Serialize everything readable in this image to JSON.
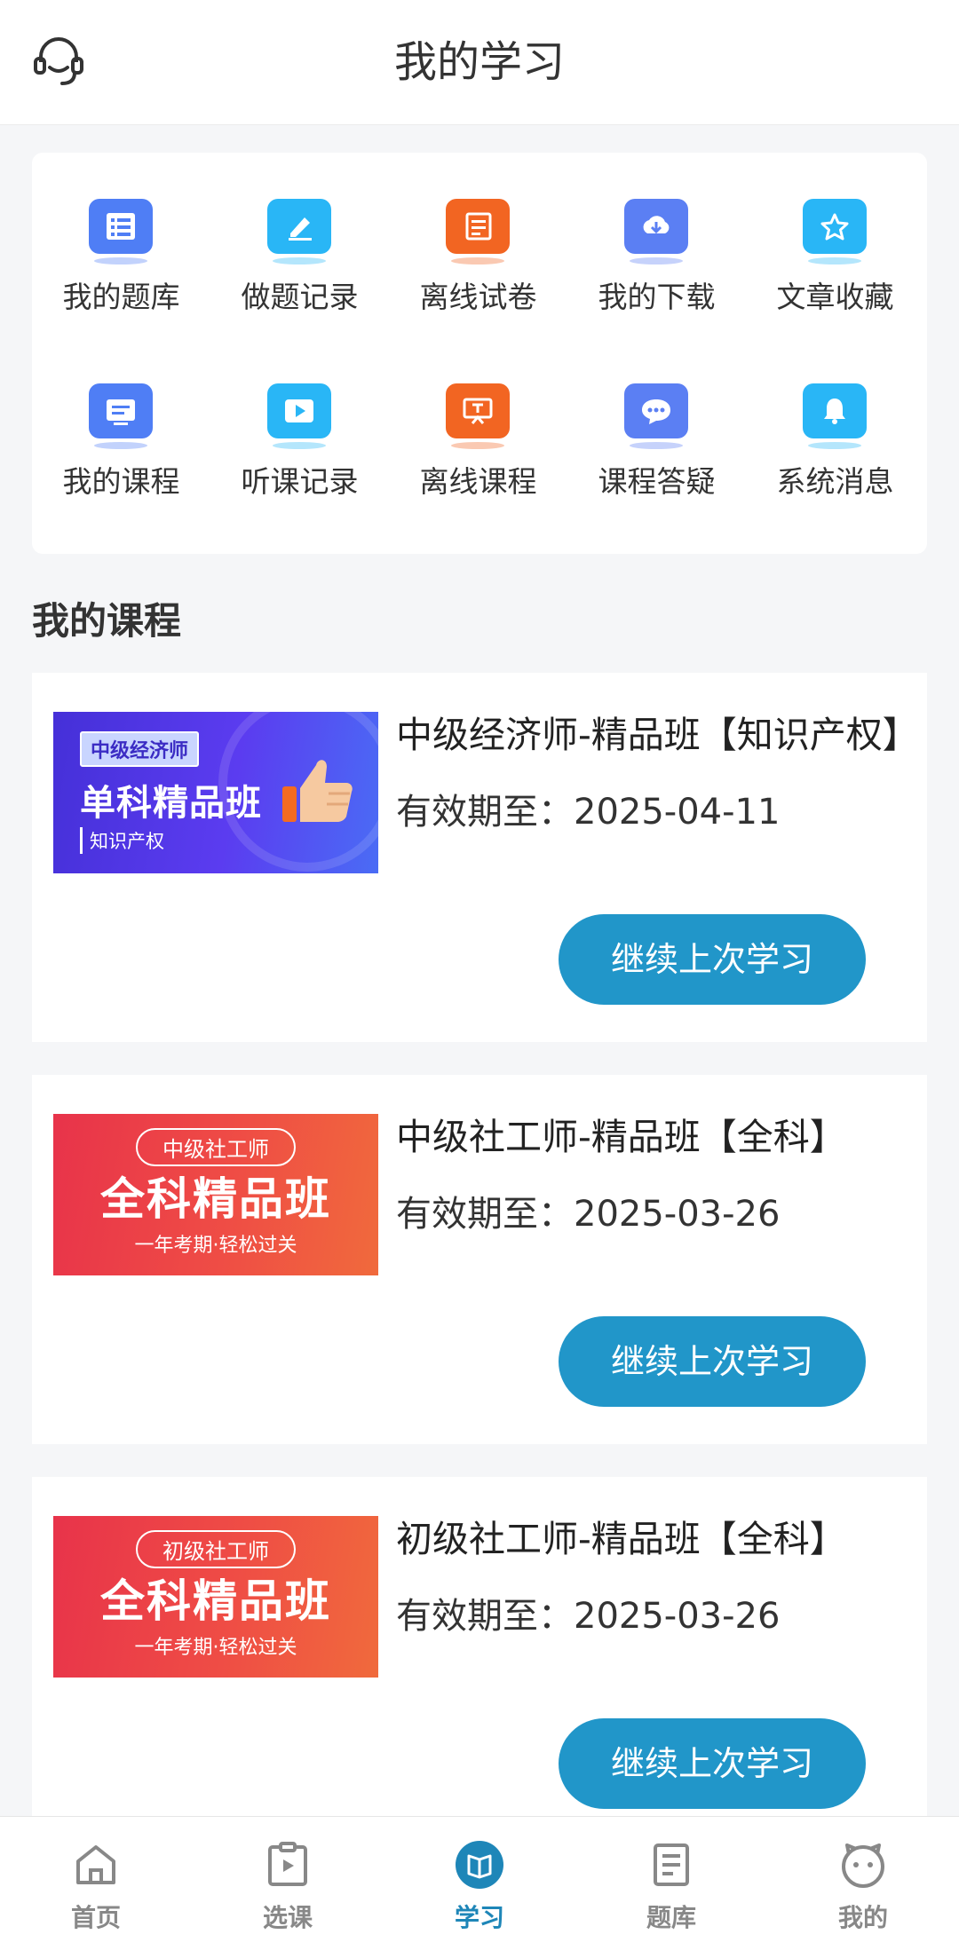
{
  "header": {
    "title": "我的学习"
  },
  "grid": [
    {
      "label": "我的题库",
      "icon": "question-bank-icon",
      "color": "#4f7ef5"
    },
    {
      "label": "做题记录",
      "icon": "edit-record-icon",
      "color": "#29b6f6"
    },
    {
      "label": "离线试卷",
      "icon": "offline-paper-icon",
      "color": "#f26522"
    },
    {
      "label": "我的下载",
      "icon": "download-icon",
      "color": "#5b7ff3"
    },
    {
      "label": "文章收藏",
      "icon": "star-icon",
      "color": "#29b6f6"
    },
    {
      "label": "我的课程",
      "icon": "course-icon",
      "color": "#4f7ef5"
    },
    {
      "label": "听课记录",
      "icon": "play-record-icon",
      "color": "#29b6f6"
    },
    {
      "label": "离线课程",
      "icon": "offline-course-icon",
      "color": "#f26522"
    },
    {
      "label": "课程答疑",
      "icon": "chat-icon",
      "color": "#5b7ff3"
    },
    {
      "label": "系统消息",
      "icon": "bell-icon",
      "color": "#29b6f6"
    }
  ],
  "section_title": "我的课程",
  "courses": [
    {
      "name": "中级经济师-精品班【知识产权】",
      "expiry": "有效期至：2025-04-11",
      "button": "继续上次学习",
      "banner": {
        "tag": "中级经济师",
        "headline": "单科精品班",
        "sub": "知识产权"
      }
    },
    {
      "name": "中级社工师-精品班【全科】",
      "expiry": "有效期至：2025-03-26",
      "button": "继续上次学习",
      "banner": {
        "tag": "中级社工师",
        "headline": "全科精品班",
        "sub": "一年考期·轻松过关"
      }
    },
    {
      "name": "初级社工师-精品班【全科】",
      "expiry": "有效期至：2025-03-26",
      "button": "继续上次学习",
      "banner": {
        "tag": "初级社工师",
        "headline": "全科精品班",
        "sub": "一年考期·轻松过关"
      }
    }
  ],
  "tabbar": [
    {
      "label": "首页",
      "icon": "home-icon"
    },
    {
      "label": "选课",
      "icon": "select-course-icon"
    },
    {
      "label": "学习",
      "icon": "study-icon",
      "active": true
    },
    {
      "label": "题库",
      "icon": "question-bank-tab-icon"
    },
    {
      "label": "我的",
      "icon": "profile-icon"
    }
  ],
  "colors": {
    "accent": "#2196c9",
    "active_tab": "#1e86b8"
  }
}
